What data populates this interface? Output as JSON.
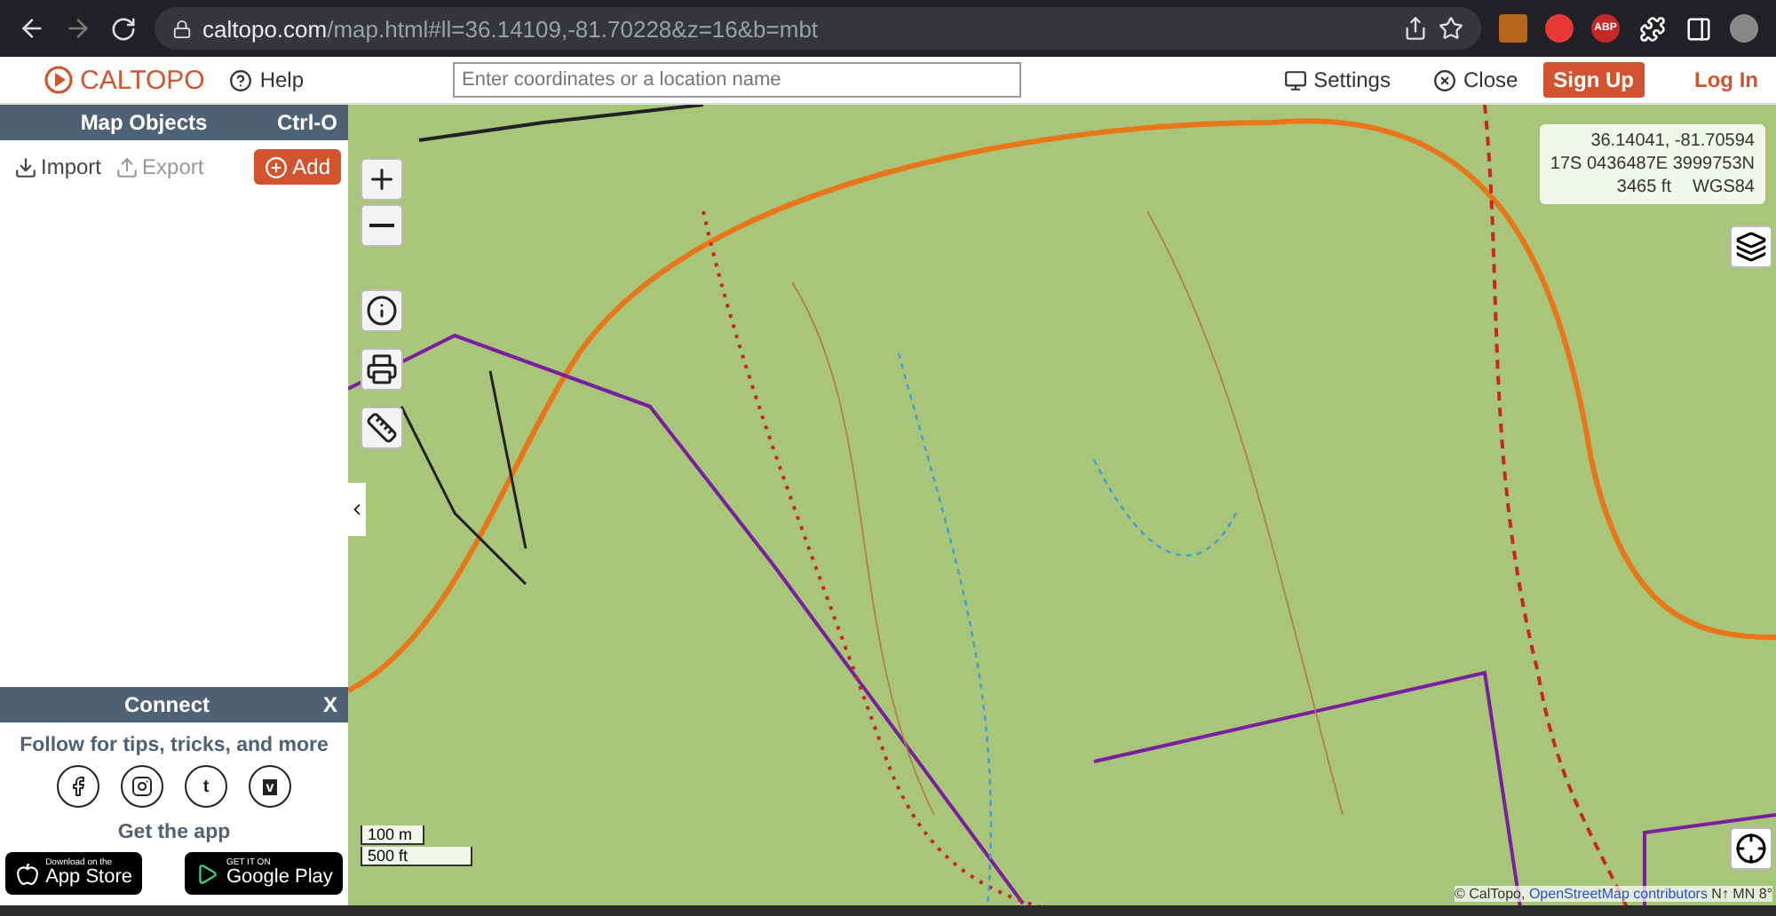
{
  "browser": {
    "url_host": "caltopo.com",
    "url_path": "/map.html#ll=36.14109,-81.70228&z=16&b=mbt",
    "extensions": [
      {
        "kind": "square"
      },
      {
        "kind": "hand"
      },
      {
        "kind": "abp",
        "label": "ABP"
      },
      {
        "kind": "puzzle"
      },
      {
        "kind": "panel"
      },
      {
        "kind": "avatar"
      }
    ]
  },
  "header": {
    "logo": "CALTOPO",
    "help": "Help",
    "search": {
      "placeholder": "Enter coordinates or a location name"
    },
    "settings": "Settings",
    "close": "Close",
    "sign_up": "Sign Up",
    "log_in": "Log In"
  },
  "sidebar": {
    "title": "Map Objects",
    "shortcut": "Ctrl-O",
    "import": "Import",
    "export": "Export",
    "export_disabled": true,
    "add": "Add"
  },
  "connect": {
    "title": "Connect",
    "close": "X",
    "follow": "Follow for tips, tricks, and more",
    "socials": [
      {
        "kind": "facebook"
      },
      {
        "kind": "instagram"
      },
      {
        "kind": "tumblr",
        "label": "t"
      },
      {
        "kind": "vimeo",
        "label": "v"
      }
    ],
    "get_app": "Get the app",
    "stores": [
      {
        "kind": "apple",
        "small": "Download on the",
        "big": "App Store"
      },
      {
        "kind": "google",
        "small": "GET IT ON",
        "big": "Google Play"
      }
    ]
  },
  "map": {
    "coords": [
      "36.14041, -81.70594",
      "17S 0436487E 3999753N"
    ],
    "elevation": "3465 ft",
    "datum": "WGS84",
    "scale": [
      "100 m",
      "500 ft"
    ],
    "attribution": "© CalTopo, ",
    "attribution_link": "OpenStreetMap contributors",
    "attribution_tail": " N↑ MN 8°"
  }
}
